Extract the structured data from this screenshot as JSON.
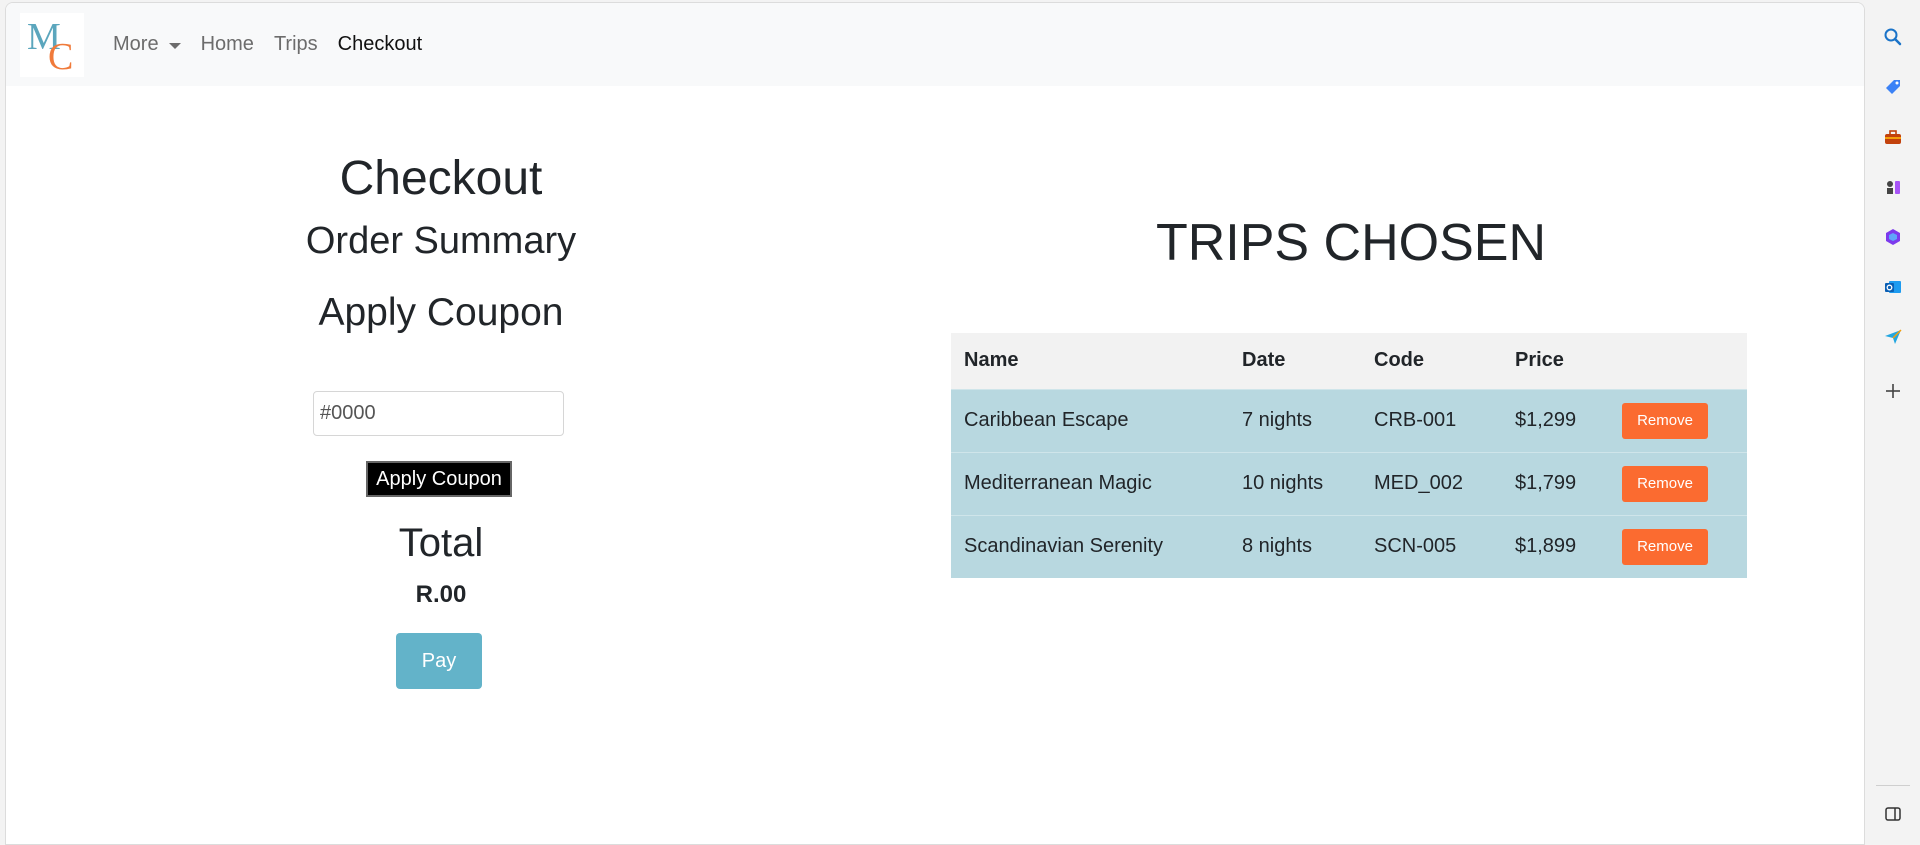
{
  "navbar": {
    "logo_m": "M",
    "logo_c": "C",
    "more_label": "More",
    "home_label": "Home",
    "trips_label": "Trips",
    "checkout_label": "Checkout"
  },
  "checkout": {
    "title": "Checkout",
    "order_summary": "Order Summary",
    "apply_coupon_heading": "Apply Coupon",
    "coupon_placeholder": "#0000",
    "apply_coupon_button": "Apply Coupon",
    "total_label": "Total",
    "total_value": "R.00",
    "pay_button": "Pay"
  },
  "trips": {
    "title": "TRIPS CHOSEN",
    "columns": [
      "Name",
      "Date",
      "Code",
      "Price"
    ],
    "rows": [
      {
        "name": "Caribbean Escape",
        "date": "7 nights",
        "code": "CRB-001",
        "price": "$1,299",
        "action": "Remove"
      },
      {
        "name": "Mediterranean Magic",
        "date": "10 nights",
        "code": "MED_002",
        "price": "$1,799",
        "action": "Remove"
      },
      {
        "name": "Scandinavian Serenity",
        "date": "8 nights",
        "code": "SCN-005",
        "price": "$1,899",
        "action": "Remove"
      }
    ]
  },
  "colors": {
    "accent_blue": "#63b3c9",
    "remove_orange": "#fb6b30",
    "row_bg": "#b8d8e0"
  },
  "sidebar": {
    "icons": [
      "search-icon",
      "tag-icon",
      "toolbox-icon",
      "chess-icon",
      "copilot-icon",
      "outlook-icon",
      "send-icon",
      "add-icon",
      "sidebar-toggle-icon"
    ]
  }
}
